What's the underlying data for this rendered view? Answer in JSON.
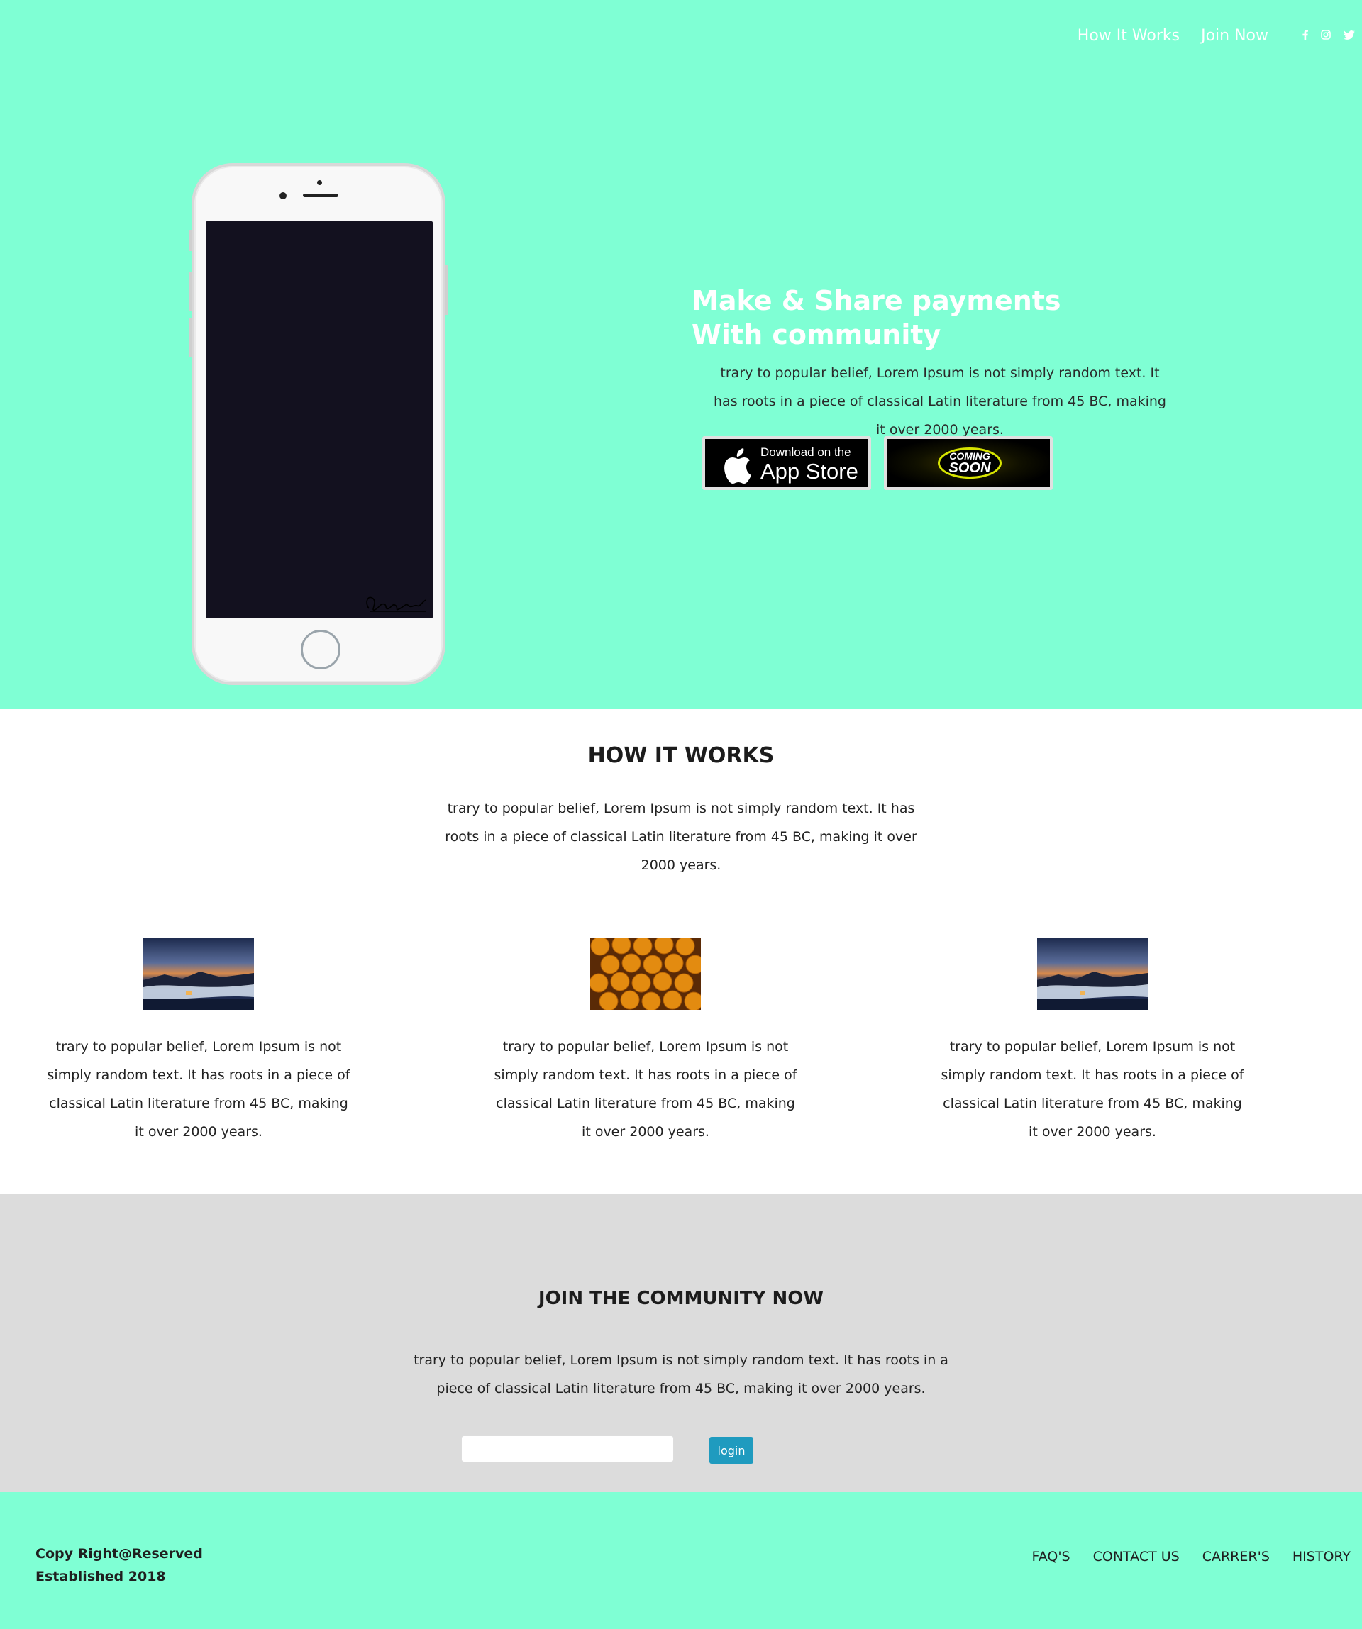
{
  "nav": {
    "links": [
      "How It Works",
      "Join Now"
    ],
    "social_icons": [
      "facebook-icon",
      "instagram-icon",
      "twitter-icon"
    ]
  },
  "hero": {
    "title_line1": "Make & Share payments",
    "title_line2": "With community",
    "text": "trary to popular belief, Lorem Ipsum is not simply random text. It has roots in a piece of classical Latin literature from 45 BC, making it over 2000 years.",
    "appstore": {
      "line1": "Download on the",
      "line2": "App Store"
    },
    "coming_soon": {
      "line1": "COMING",
      "line2": "SOON"
    }
  },
  "how": {
    "title": "HOW IT WORKS",
    "intro": "trary to popular belief, Lorem Ipsum is not simply random text. It has roots in a piece of classical Latin literature from 45 BC, making it over 2000 years.",
    "features": [
      {
        "image": "mountain-landscape-image",
        "text": "trary to popular belief, Lorem Ipsum is not simply random text. It has roots in a piece of classical Latin literature from 45 BC, making it over 2000 years."
      },
      {
        "image": "oranges-image",
        "text": "trary to popular belief, Lorem Ipsum is not simply random text. It has roots in a piece of classical Latin literature from 45 BC, making it over 2000 years."
      },
      {
        "image": "mountain-landscape-image",
        "text": "trary to popular belief, Lorem Ipsum is not simply random text. It has roots in a piece of classical Latin literature from 45 BC, making it over 2000 years."
      }
    ]
  },
  "join": {
    "title": "JOIN THE COMMUNITY NOW",
    "intro": "trary to popular belief, Lorem Ipsum is not simply random text. It has roots in a piece of classical Latin literature from 45 BC, making it over 2000 years.",
    "input_value": "",
    "button_label": "login"
  },
  "footer": {
    "copyright": "Copy Right@Reserved",
    "established": "Established 2018",
    "links": [
      "FAQ'S",
      "CONTACT US",
      "CARRER'S",
      "HISTORY"
    ]
  },
  "colors": {
    "accent": "#7fffd4",
    "join_bg": "#dcdcdc",
    "button": "#1f9bbf"
  }
}
